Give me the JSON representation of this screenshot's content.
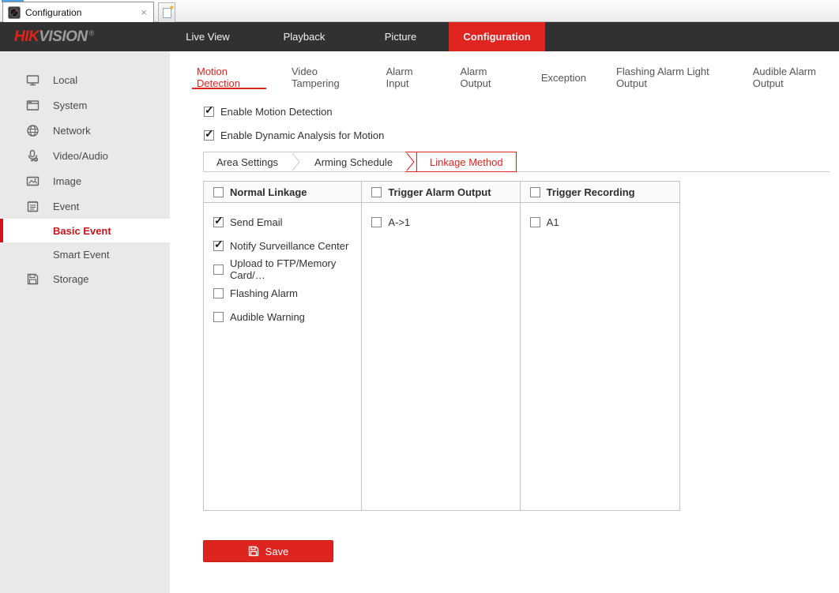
{
  "colors": {
    "accent": "#e0241f",
    "logo_red": "#e2231a",
    "header_bg": "#313131",
    "sidebar_bg": "#e9e9e9",
    "selected_red": "#d0121b"
  },
  "browser": {
    "tab_title": "Configuration",
    "close_glyph": "×",
    "favicon": "camera-icon",
    "new_tab_icon": "new-tab-page-star-icon"
  },
  "header": {
    "logo_red": "HIK",
    "logo_gray": "VISION",
    "logo_reg": "®",
    "nav": [
      {
        "label": "Live View",
        "active": false
      },
      {
        "label": "Playback",
        "active": false
      },
      {
        "label": "Picture",
        "active": false
      },
      {
        "label": "Configuration",
        "active": true
      }
    ]
  },
  "sidebar": {
    "items": [
      {
        "label": "Local",
        "icon": "monitor-icon"
      },
      {
        "label": "System",
        "icon": "window-icon"
      },
      {
        "label": "Network",
        "icon": "globe-icon"
      },
      {
        "label": "Video/Audio",
        "icon": "microphone-icon"
      },
      {
        "label": "Image",
        "icon": "image-icon"
      },
      {
        "label": "Event",
        "icon": "notepad-icon"
      },
      {
        "label": "Basic Event",
        "child": true,
        "selected": true
      },
      {
        "label": "Smart Event",
        "child": true,
        "selected": false
      },
      {
        "label": "Storage",
        "icon": "floppy-icon"
      }
    ]
  },
  "content": {
    "tabs": [
      {
        "label": "Motion Detection",
        "active": true
      },
      {
        "label": "Video Tampering",
        "active": false
      },
      {
        "label": "Alarm Input",
        "active": false
      },
      {
        "label": "Alarm Output",
        "active": false
      },
      {
        "label": "Exception",
        "active": false
      },
      {
        "label": "Flashing Alarm Light Output",
        "active": false
      },
      {
        "label": "Audible Alarm Output",
        "active": false
      }
    ],
    "enable": [
      {
        "label": "Enable Motion Detection",
        "checked": true
      },
      {
        "label": "Enable Dynamic Analysis for Motion",
        "checked": true
      }
    ],
    "subtabs": [
      {
        "label": "Area Settings",
        "active": false
      },
      {
        "label": "Arming Schedule",
        "active": false
      },
      {
        "label": "Linkage Method",
        "active": true
      }
    ],
    "table": {
      "columns": [
        {
          "header": "Normal Linkage",
          "header_checked": false,
          "items": [
            {
              "label": "Send Email",
              "checked": true
            },
            {
              "label": "Notify Surveillance Center",
              "checked": true
            },
            {
              "label": "Upload to FTP/Memory Card/…",
              "checked": false
            },
            {
              "label": "Flashing Alarm",
              "checked": false
            },
            {
              "label": "Audible Warning",
              "checked": false
            }
          ]
        },
        {
          "header": "Trigger Alarm Output",
          "header_checked": false,
          "items": [
            {
              "label": "A->1",
              "checked": false
            }
          ]
        },
        {
          "header": "Trigger Recording",
          "header_checked": false,
          "items": [
            {
              "label": "A1",
              "checked": false
            }
          ]
        }
      ]
    },
    "save_label": "Save"
  }
}
